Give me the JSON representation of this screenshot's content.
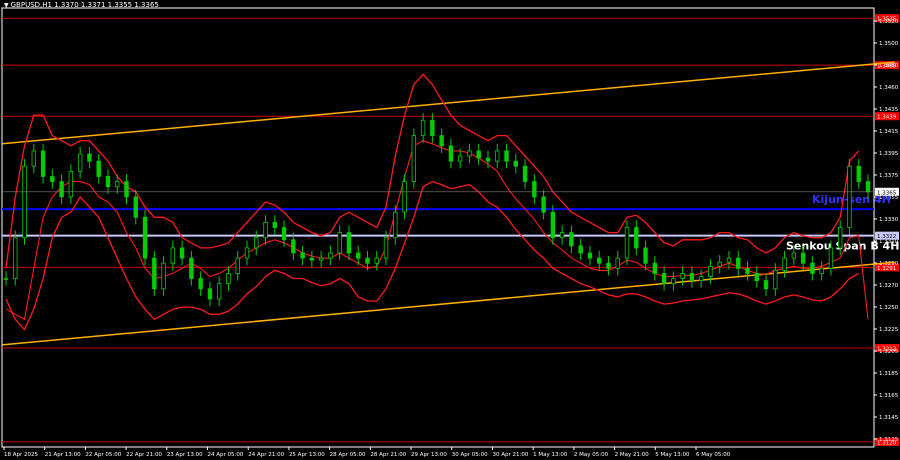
{
  "header": {
    "symbol_line": "GBPUSD,H1  1.3370 1.3371 1.3355 1.3365"
  },
  "chart_data": {
    "type": "candlestick",
    "symbol": "GBPUSD",
    "timeframe": "H1",
    "ohlc_header": {
      "open": 1.337,
      "high": 1.3371,
      "low": 1.3355,
      "close": 1.3365
    },
    "colors": {
      "background": "#000000",
      "axis": "#ffffff",
      "candles": "#00cc00",
      "bands": "#ff1a1a",
      "level_lines": "#cc0000",
      "channel": "#ffb000",
      "kijun": "#0000ff",
      "kijun_label": "#3333ff",
      "senkou": "#c9c9ff",
      "senkou_label": "#ffffff",
      "price_box": "#ff0000"
    },
    "ylim": [
      1.3115,
      1.3545
    ],
    "y_ticks": [
      "1.3520",
      "1.3500",
      "1.3480",
      "1.3460",
      "1.3435",
      "1.3415",
      "1.3395",
      "1.3375",
      "1.3355",
      "1.3330",
      "1.3310",
      "1.3290",
      "1.3270",
      "1.3250",
      "1.3225",
      "1.3205",
      "1.3185",
      "1.3165",
      "1.3145",
      "1.3125"
    ],
    "x_ticks": [
      "18 Apr 2025",
      "21 Apr 13:00",
      "22 Apr 05:00",
      "22 Apr 21:00",
      "23 Apr 13:00",
      "24 Apr 05:00",
      "24 Apr 21:00",
      "25 Apr 13:00",
      "28 Apr 05:00",
      "28 Apr 21:00",
      "29 Apr 13:00",
      "30 Apr 05:00",
      "30 Apr 21:00",
      "1 May 13:00",
      "2 May 05:00",
      "2 May 21:00",
      "5 May 13:00",
      "6 May 05:00"
    ],
    "levels": [
      {
        "value": 1.3535,
        "label": "1.3535"
      },
      {
        "value": 1.3489,
        "label": "1.3489"
      },
      {
        "value": 1.3439,
        "label": "1.3439"
      },
      {
        "value": 1.3291,
        "label": "1.3291"
      },
      {
        "value": 1.3212,
        "label": "1.3212"
      },
      {
        "value": 1.312,
        "label": "1.3120"
      }
    ],
    "kijun": {
      "value": 1.3348,
      "label": "Kijun-sen 4H"
    },
    "senkou": {
      "value": 1.3322,
      "label": "Senkou Span B 4H",
      "tag": "1.3322"
    },
    "current_price": {
      "value": 1.3365,
      "label": "1.3365"
    },
    "channel_upper": {
      "x": [
        0,
        130
      ],
      "y": [
        1.3412,
        1.3492
      ]
    },
    "channel_lower": {
      "x": [
        0,
        130
      ],
      "y": [
        1.3215,
        1.3296
      ]
    },
    "closes": [
      1.328,
      1.332,
      1.339,
      1.3405,
      1.338,
      1.3375,
      1.336,
      1.3385,
      1.3402,
      1.3395,
      1.338,
      1.337,
      1.3375,
      1.336,
      1.334,
      1.33,
      1.327,
      1.3295,
      1.331,
      1.33,
      1.328,
      1.327,
      1.326,
      1.3275,
      1.3285,
      1.33,
      1.331,
      1.332,
      1.3335,
      1.333,
      1.3318,
      1.3305,
      1.33,
      1.3298,
      1.33,
      1.3305,
      1.3325,
      1.3305,
      1.33,
      1.3295,
      1.33,
      1.332,
      1.3345,
      1.3375,
      1.342,
      1.3435,
      1.342,
      1.341,
      1.3395,
      1.34,
      1.3405,
      1.3398,
      1.3395,
      1.3405,
      1.3395,
      1.339,
      1.3375,
      1.336,
      1.3345,
      1.332,
      1.3325,
      1.3312,
      1.3305,
      1.33,
      1.3295,
      1.329,
      1.33,
      1.333,
      1.331,
      1.3295,
      1.3285,
      1.3275,
      1.328,
      1.3285,
      1.3278,
      1.3282,
      1.3292,
      1.3296,
      1.33,
      1.329,
      1.3285,
      1.3278,
      1.327,
      1.3288,
      1.33,
      1.3305,
      1.3295,
      1.3285,
      1.329,
      1.331,
      1.333,
      1.339,
      1.3375,
      1.3365
    ],
    "upper_band": [
      1.329,
      1.336,
      1.341,
      1.344,
      1.344,
      1.342,
      1.3415,
      1.341,
      1.3415,
      1.3415,
      1.3405,
      1.3395,
      1.338,
      1.337,
      1.3365,
      1.335,
      1.334,
      1.334,
      1.3335,
      1.332,
      1.3315,
      1.331,
      1.331,
      1.3312,
      1.3315,
      1.3325,
      1.3335,
      1.3345,
      1.3355,
      1.3352,
      1.3345,
      1.3335,
      1.333,
      1.3325,
      1.3322,
      1.3325,
      1.334,
      1.3345,
      1.334,
      1.3335,
      1.333,
      1.335,
      1.34,
      1.344,
      1.347,
      1.348,
      1.347,
      1.3455,
      1.344,
      1.343,
      1.3425,
      1.342,
      1.3415,
      1.342,
      1.342,
      1.341,
      1.34,
      1.339,
      1.338,
      1.3365,
      1.3355,
      1.3345,
      1.334,
      1.3335,
      1.333,
      1.3325,
      1.3325,
      1.334,
      1.3342,
      1.3335,
      1.3325,
      1.3315,
      1.3312,
      1.3318,
      1.3318,
      1.3318,
      1.332,
      1.3325,
      1.3325,
      1.332,
      1.3318,
      1.331,
      1.3305,
      1.331,
      1.332,
      1.3325,
      1.3322,
      1.332,
      1.332,
      1.3325,
      1.334,
      1.3395,
      1.3405
    ],
    "lower_band": [
      1.326,
      1.324,
      1.323,
      1.325,
      1.328,
      1.332,
      1.334,
      1.3345,
      1.336,
      1.335,
      1.334,
      1.332,
      1.33,
      1.328,
      1.3262,
      1.325,
      1.324,
      1.3245,
      1.325,
      1.3252,
      1.3252,
      1.325,
      1.3245,
      1.3245,
      1.3248,
      1.3255,
      1.3265,
      1.3272,
      1.3282,
      1.3288,
      1.3285,
      1.328,
      1.328,
      1.3276,
      1.3273,
      1.3275,
      1.328,
      1.3275,
      1.3262,
      1.3258,
      1.3258,
      1.327,
      1.329,
      1.3315,
      1.334,
      1.337,
      1.3375,
      1.3372,
      1.3368,
      1.337,
      1.3372,
      1.3365,
      1.3355,
      1.335,
      1.334,
      1.3328,
      1.3318,
      1.3308,
      1.33,
      1.329,
      1.3285,
      1.328,
      1.3275,
      1.3272,
      1.3268,
      1.3264,
      1.3262,
      1.3265,
      1.3265,
      1.3262,
      1.3258,
      1.3255,
      1.3256,
      1.3258,
      1.3259,
      1.326,
      1.3262,
      1.3264,
      1.3266,
      1.3265,
      1.3262,
      1.3258,
      1.3255,
      1.3258,
      1.3262,
      1.3264,
      1.3262,
      1.3259,
      1.3258,
      1.3262,
      1.327,
      1.328,
      1.3285
    ],
    "mid_line": [
      1.325,
      1.3245,
      1.324,
      1.329,
      1.334,
      1.336,
      1.337,
      1.3375,
      1.3375,
      1.3372,
      1.336,
      1.3355,
      1.3345,
      1.3325,
      1.331,
      1.329,
      1.328,
      1.3282,
      1.3285,
      1.329,
      1.3295,
      1.329,
      1.3282,
      1.3285,
      1.329,
      1.3298,
      1.3305,
      1.331,
      1.3315,
      1.3318,
      1.3315,
      1.331,
      1.3305,
      1.3302,
      1.33,
      1.33,
      1.3305,
      1.33,
      1.3295,
      1.329,
      1.3292,
      1.331,
      1.3345,
      1.338,
      1.341,
      1.3415,
      1.3412,
      1.3408,
      1.3405,
      1.3405,
      1.3403,
      1.3398,
      1.3392,
      1.3385,
      1.337,
      1.3358,
      1.3348,
      1.3338,
      1.3325,
      1.3315,
      1.3308,
      1.33,
      1.3295,
      1.329,
      1.3288,
      1.3288,
      1.3292,
      1.3298,
      1.3296,
      1.329,
      1.3285,
      1.3282,
      1.3282,
      1.3283,
      1.3283,
      1.3285,
      1.3288,
      1.3292,
      1.3295,
      1.3292,
      1.3288,
      1.3285,
      1.3284,
      1.3288,
      1.329,
      1.3292,
      1.329,
      1.329,
      1.3292,
      1.3296,
      1.33,
      1.332,
      1.3322,
      1.324
    ]
  }
}
